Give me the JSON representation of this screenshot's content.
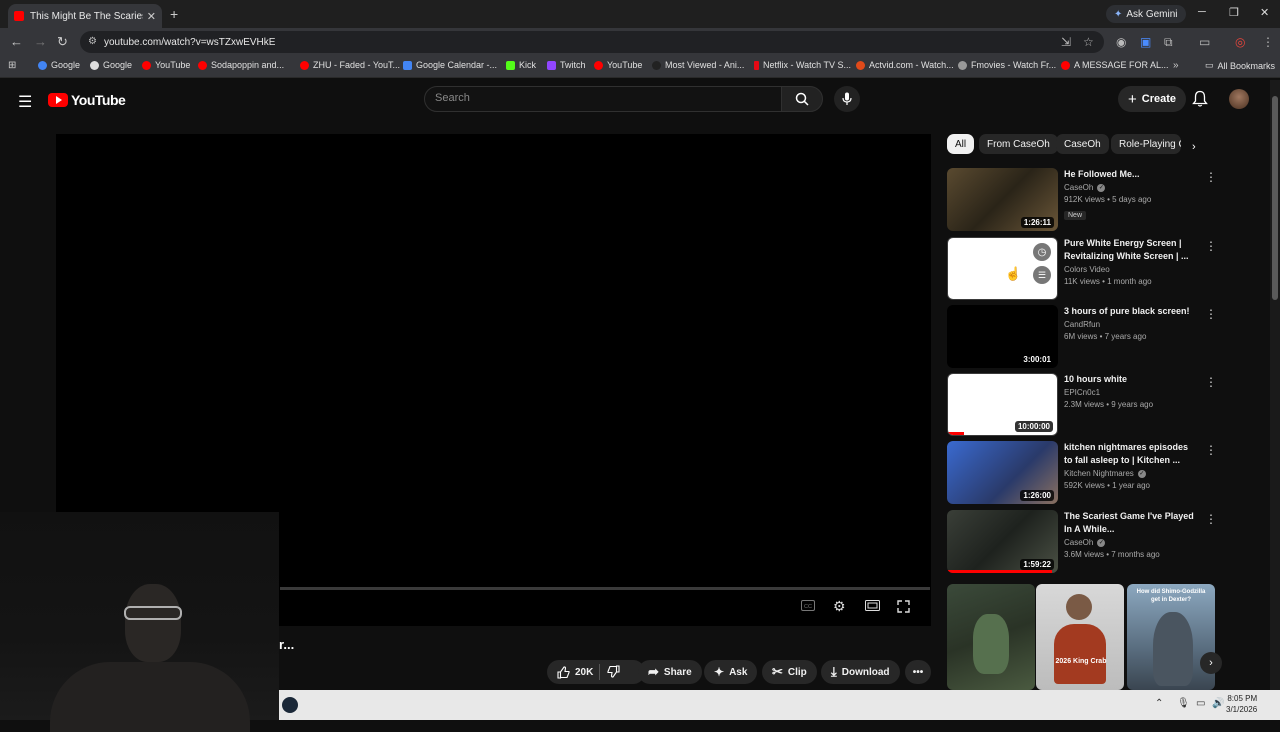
{
  "browser": {
    "tab_title": "This Might Be The Scariest Dem",
    "url": "youtube.com/watch?v=wsTZxwEVHkE",
    "ask_gemini": "Ask Gemini",
    "bookmarks": [
      "Google",
      "Google",
      "YouTube",
      "Sodapoppin and...",
      "ZHU - Faded - YouT...",
      "Google Calendar -...",
      "Kick",
      "Twitch",
      "YouTube",
      "Most Viewed - Ani...",
      "Netflix - Watch TV S...",
      "Actvid.com - Watch...",
      "Fmovies - Watch Fr...",
      "A MESSAGE FOR AL..."
    ],
    "all_bookmarks": "All Bookmarks"
  },
  "yt": {
    "logo": "YouTube",
    "search_placeholder": "Search",
    "create": "Create",
    "title_fragment": "r...",
    "actions": {
      "likes": "20K",
      "share": "Share",
      "ask": "Ask",
      "clip": "Clip",
      "download": "Download"
    },
    "chips": [
      "All",
      "From CaseOh",
      "CaseOh",
      "Role-Playing G"
    ],
    "videos": [
      {
        "title": "He Followed Me...",
        "channel": "CaseOh",
        "verified": true,
        "meta": "912K views • 5 days ago",
        "badge": "New",
        "duration": "1:26:11",
        "progress": 0
      },
      {
        "title": "Pure White Energy Screen | Revitalizing White Screen | ...",
        "channel": "Colors Video",
        "verified": false,
        "meta": "11K views • 1 month ago",
        "badge": "",
        "duration": "",
        "progress": 0
      },
      {
        "title": "3 hours of pure black screen!",
        "channel": "CandRfun",
        "verified": false,
        "meta": "6M views • 7 years ago",
        "badge": "",
        "duration": "3:00:01",
        "progress": 0
      },
      {
        "title": "10 hours white",
        "channel": "EPICn0c1",
        "verified": false,
        "meta": "2.3M views • 9 years ago",
        "badge": "",
        "duration": "10:00:00",
        "progress": 0.15
      },
      {
        "title": "kitchen nightmares episodes to fall asleep to | Kitchen ...",
        "channel": "Kitchen Nightmares",
        "verified": true,
        "meta": "592K views • 1 year ago",
        "badge": "",
        "duration": "1:26:00",
        "progress": 0
      },
      {
        "title": "The Scariest Game I've Played In A While...",
        "channel": "CaseOh",
        "verified": true,
        "meta": "3.6M views • 7 months ago",
        "badge": "",
        "duration": "1:59:22",
        "progress": 0.95
      }
    ]
  },
  "taskbar": {
    "time": "8:05 PM",
    "date": "3/1/2026"
  },
  "colors": {
    "brand_red": "#ff0000",
    "page_bg": "#0f0f0f",
    "chip_bg": "#272727"
  }
}
